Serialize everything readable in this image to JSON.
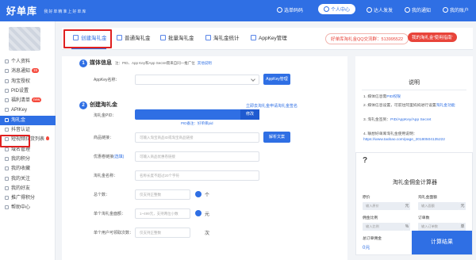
{
  "header": {
    "logo": "好单库",
    "tagline": "我好单精准上好单库",
    "nav": [
      {
        "label": "选单码码"
      },
      {
        "label": "个人中心"
      },
      {
        "label": "达人发发"
      },
      {
        "label": "我的通知"
      },
      {
        "label": "我的账户"
      }
    ]
  },
  "sidebar": {
    "items": [
      {
        "label": "个人资料"
      },
      {
        "label": "消息通知",
        "badge": "15"
      },
      {
        "label": "淘宝授权"
      },
      {
        "label": "PID设置"
      },
      {
        "label": "福利清单",
        "badge": "new"
      },
      {
        "label": "APIKey"
      },
      {
        "label": "淘礼金"
      },
      {
        "label": "抖音认证"
      },
      {
        "label": "短视频拉货列表"
      },
      {
        "label": "域名管理"
      },
      {
        "label": "我的积分"
      },
      {
        "label": "我的收藏"
      },
      {
        "label": "我的关注"
      },
      {
        "label": "我的好友"
      },
      {
        "label": "推广得积分"
      },
      {
        "label": "帮助中心"
      }
    ]
  },
  "tabs": [
    {
      "label": "创建淘礼金"
    },
    {
      "label": "普通淘礼金"
    },
    {
      "label": "批量淘礼金"
    },
    {
      "label": "淘礼金统计"
    },
    {
      "label": "AppKey管理"
    }
  ],
  "qq_group": "好单库淘礼金QQ交流群：513995522",
  "manual_tab": "我的淘礼金'使用指南'",
  "form": {
    "sec1": {
      "num": "1",
      "title": "媒体信息",
      "hint": "注：PID、App Key和App Secret需来自同一推广位",
      "link": "其他说明"
    },
    "appkey_label": "AppKey名称：",
    "appkey_button": "AppKey管理",
    "sec2": {
      "num": "2",
      "title": "创建淘礼金",
      "link": "立即去淘礼金申请淘礼金签名"
    },
    "pid_label": "淘礼金PID：",
    "pid_edit": "修改",
    "pid_note": "PID备注：好单库pid",
    "goods_label": "商品链接：",
    "goods_placeholder": "可输入淘宝商品ID或淘宝商品链接",
    "parse_button": "解析文案",
    "coupon_label": "优惠卷链接",
    "coupon_tip": "(选填)",
    "coupon_placeholder": "可输入商品优惠卷链接",
    "name_label": "淘礼金名称：",
    "name_placeholder": "名称长度不超过20个字符",
    "total_label": "总个数：",
    "total_placeholder": "仅支持正整数",
    "total_unit": "个",
    "amount_label": "单个淘礼金面额：",
    "amount_placeholder": "1~499元，支持两位小数",
    "amount_unit": "元",
    "peruser_label": "单个用户可领取次数：",
    "peruser_placeholder": "仅支持正整数",
    "peruser_unit": "次"
  },
  "description": {
    "title": "说明",
    "lines": [
      {
        "text": "1. 媒体信息需",
        "link": "PID权限"
      },
      {
        "text": "2. 媒体信息设置，可前往阿里妈妈进行设置",
        "link": "淘礼金功能"
      },
      {
        "text": "3. 淘礼金签到：",
        "link": "PID/AppKey/App Secret"
      },
      {
        "text": "4. 联想好单库淘礼金使用说明：",
        "link": "https://www.taobao.com/page_20180504135222"
      }
    ]
  },
  "calculator": {
    "icon": "?",
    "title": "淘礼金佣金计算器",
    "fields": [
      {
        "label": "原价",
        "placeholder": "输入原价",
        "unit": "元"
      },
      {
        "label": "淘礼金面额",
        "placeholder": "输入面额",
        "unit": "元"
      },
      {
        "label": "佣金比例",
        "placeholder": "输入比例",
        "unit": "%"
      },
      {
        "label": "订单数",
        "placeholder": "输入订单数",
        "unit": "单"
      }
    ],
    "total_label": "总订单佣金",
    "total_value": "0元",
    "button": "计算结果"
  }
}
